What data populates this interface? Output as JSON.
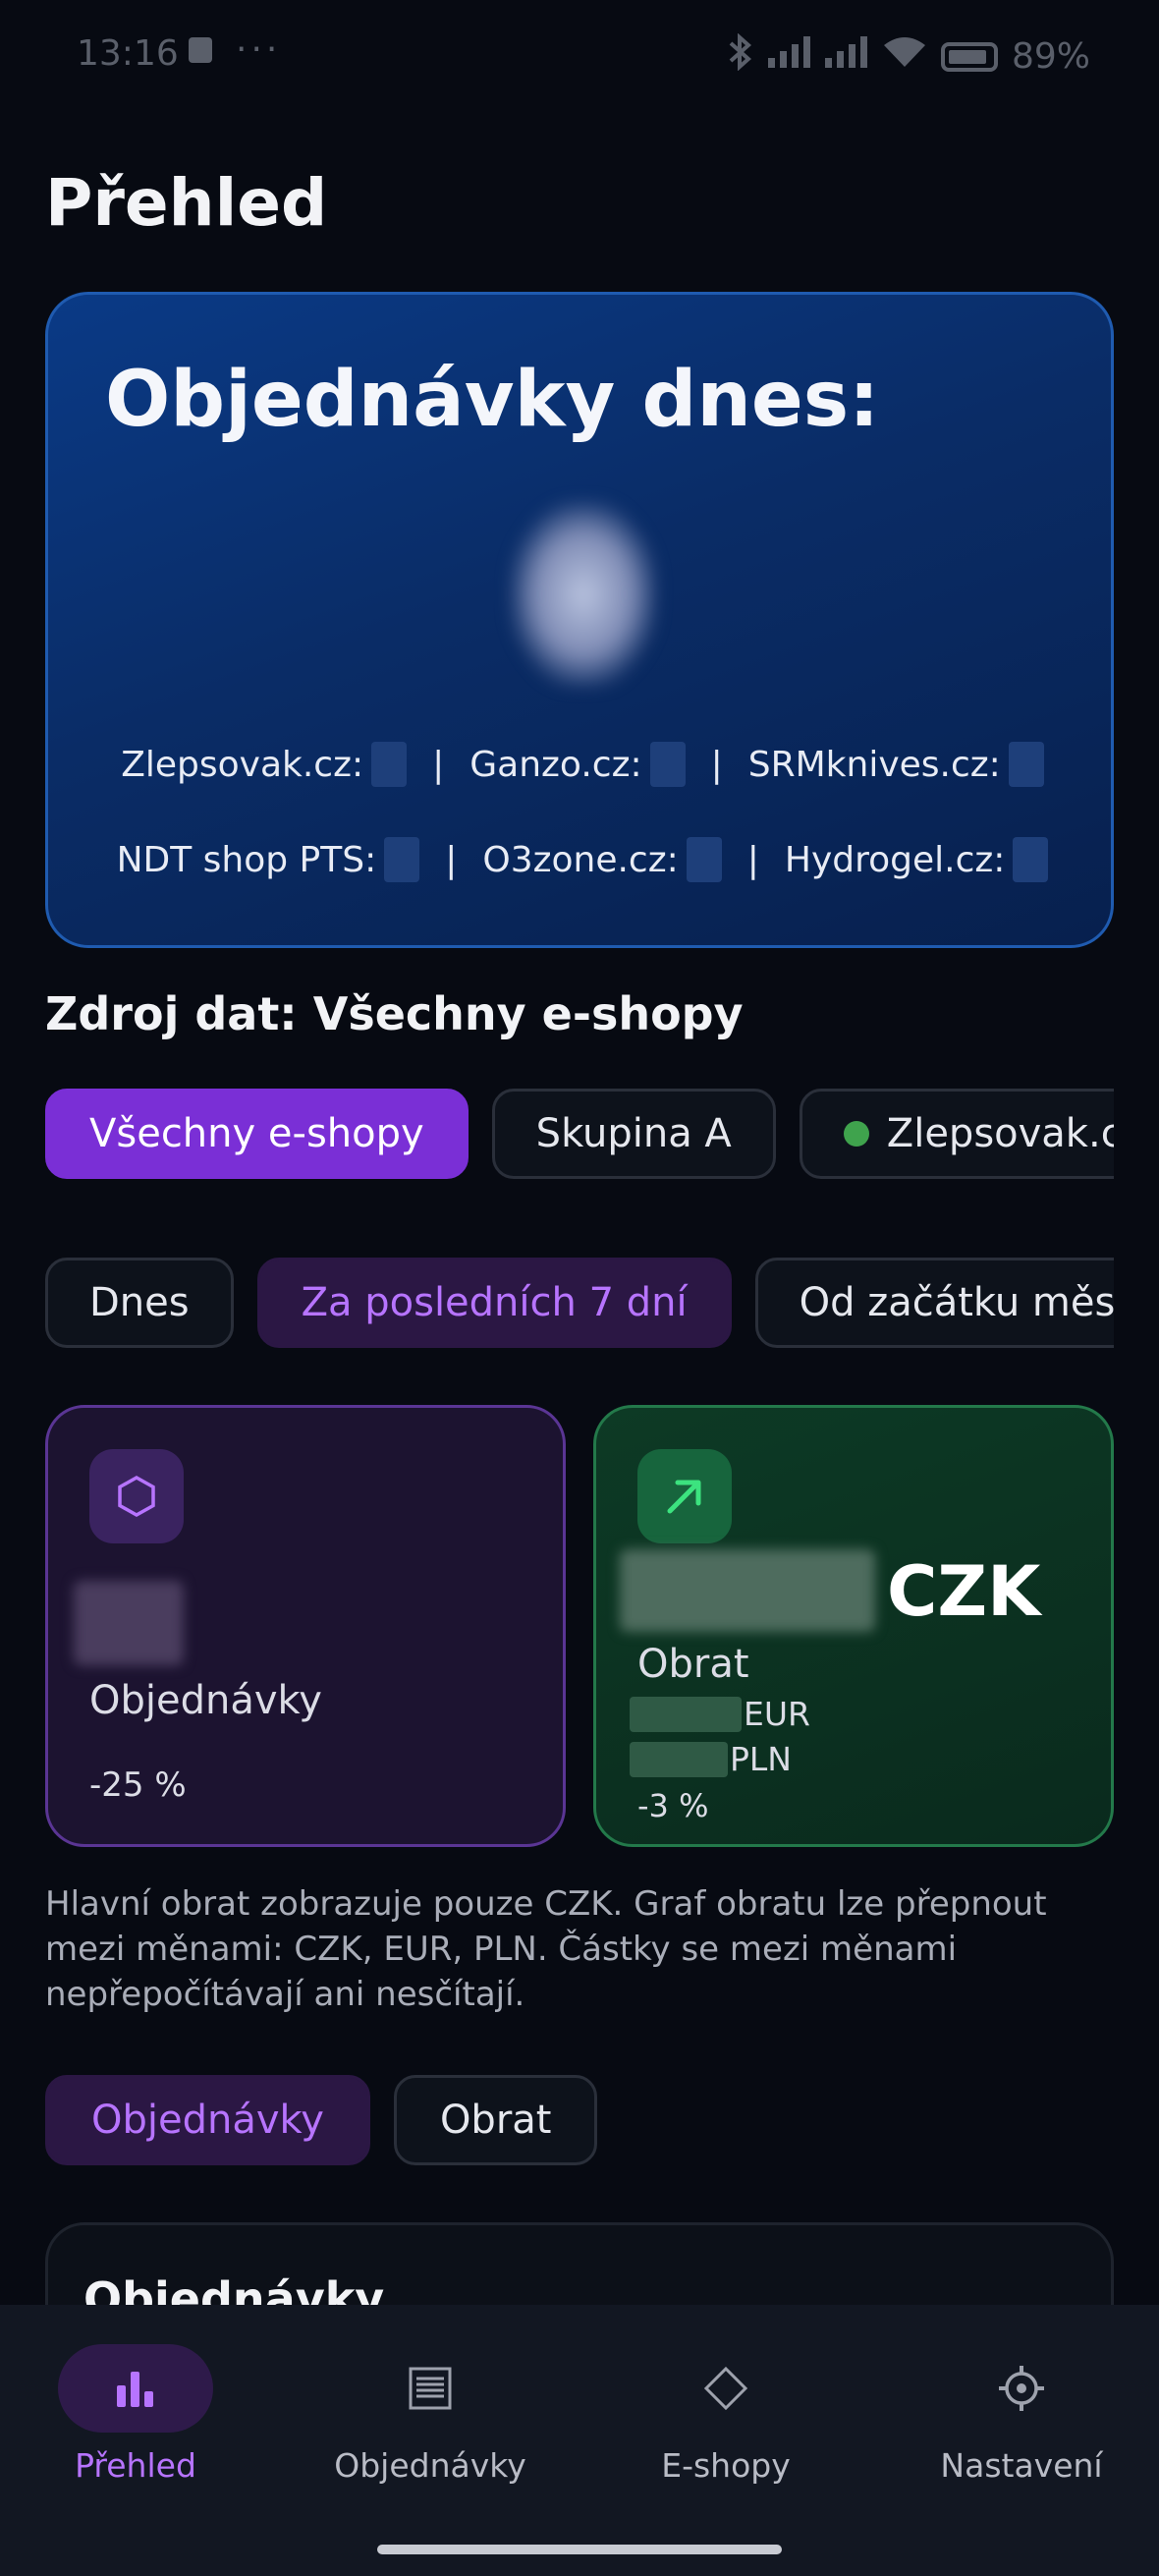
{
  "status_bar": {
    "time": "13:16",
    "dots": "···",
    "battery": "89%"
  },
  "header": {
    "title": "Přehled"
  },
  "today": {
    "title": "Objednávky dnes:",
    "count": "2",
    "shops": [
      {
        "label": "Zlepsovak.cz:"
      },
      {
        "label": "Ganzo.cz:"
      },
      {
        "label": "SRMknives.cz:"
      },
      {
        "label": "NDT shop PTS:"
      },
      {
        "label": "O3zone.cz:"
      },
      {
        "label": "Hydrogel.cz:"
      }
    ],
    "separator": "|"
  },
  "source": {
    "heading": "Zdroj dat: Všechny e-shopy",
    "chips": [
      "Všechny e-shopy",
      "Skupina A",
      "Zlepsovak.cz"
    ],
    "selected": "Všechny e-shopy",
    "status_color": "#3fa34d"
  },
  "period": {
    "chips": [
      "Dnes",
      "Za posledních 7 dní",
      "Od začátku měsíce"
    ],
    "selected": "Za posledních 7 dní"
  },
  "stats": {
    "orders": {
      "icon": "hexagon-icon",
      "value": "",
      "label": "Objednávky",
      "change": "-25 %"
    },
    "revenue": {
      "icon": "arrow-up-right-icon",
      "value": "",
      "currency": "CZK",
      "label": "Obrat",
      "sub": [
        "EUR",
        "PLN"
      ],
      "change": "-3 %"
    }
  },
  "note": "Hlavní obrat zobrazuje pouze CZK. Graf obratu lze přepnout mezi měnami: CZK, EUR, PLN. Částky se mezi měnami nepřepočítávají ani nesčítají.",
  "chart_toggle": {
    "options": [
      "Objednávky",
      "Obrat"
    ],
    "selected": "Objednávky"
  },
  "graph": {
    "title": "Objednávky"
  },
  "nav": {
    "items": [
      {
        "label": "Přehled",
        "icon": "bar-chart-icon"
      },
      {
        "label": "Objednávky",
        "icon": "list-icon"
      },
      {
        "label": "E-shopy",
        "icon": "diamond-icon"
      },
      {
        "label": "Nastavení",
        "icon": "gear-icon"
      }
    ],
    "active": "Přehled"
  },
  "colors": {
    "accent": "#7a2fd6",
    "accent_text": "#b774ff",
    "revenue_green": "#23794a",
    "hero_blue": "#0a3a86"
  }
}
